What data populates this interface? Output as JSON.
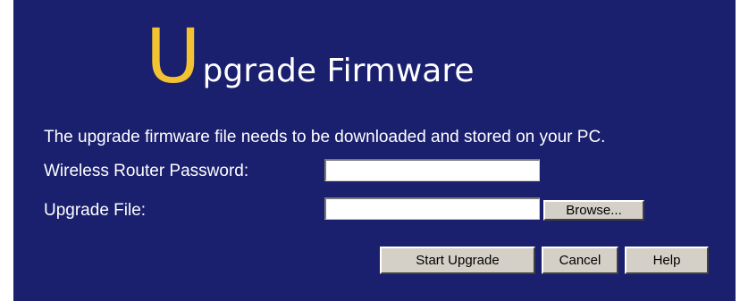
{
  "header": {
    "title_initial": "U",
    "title_rest": "pgrade Firmware"
  },
  "form": {
    "description": "The upgrade firmware file needs to be downloaded and stored on your PC.",
    "password_label": "Wireless Router Password:",
    "password_value": "",
    "file_label": "Upgrade File:",
    "file_value": "",
    "browse_label": "Browse..."
  },
  "actions": {
    "start_label": "Start Upgrade",
    "cancel_label": "Cancel",
    "help_label": "Help"
  },
  "colors": {
    "background": "#1a1f6e",
    "title_accent": "#f2c232",
    "text": "#ffffff",
    "button_face": "#d4d0c8"
  }
}
